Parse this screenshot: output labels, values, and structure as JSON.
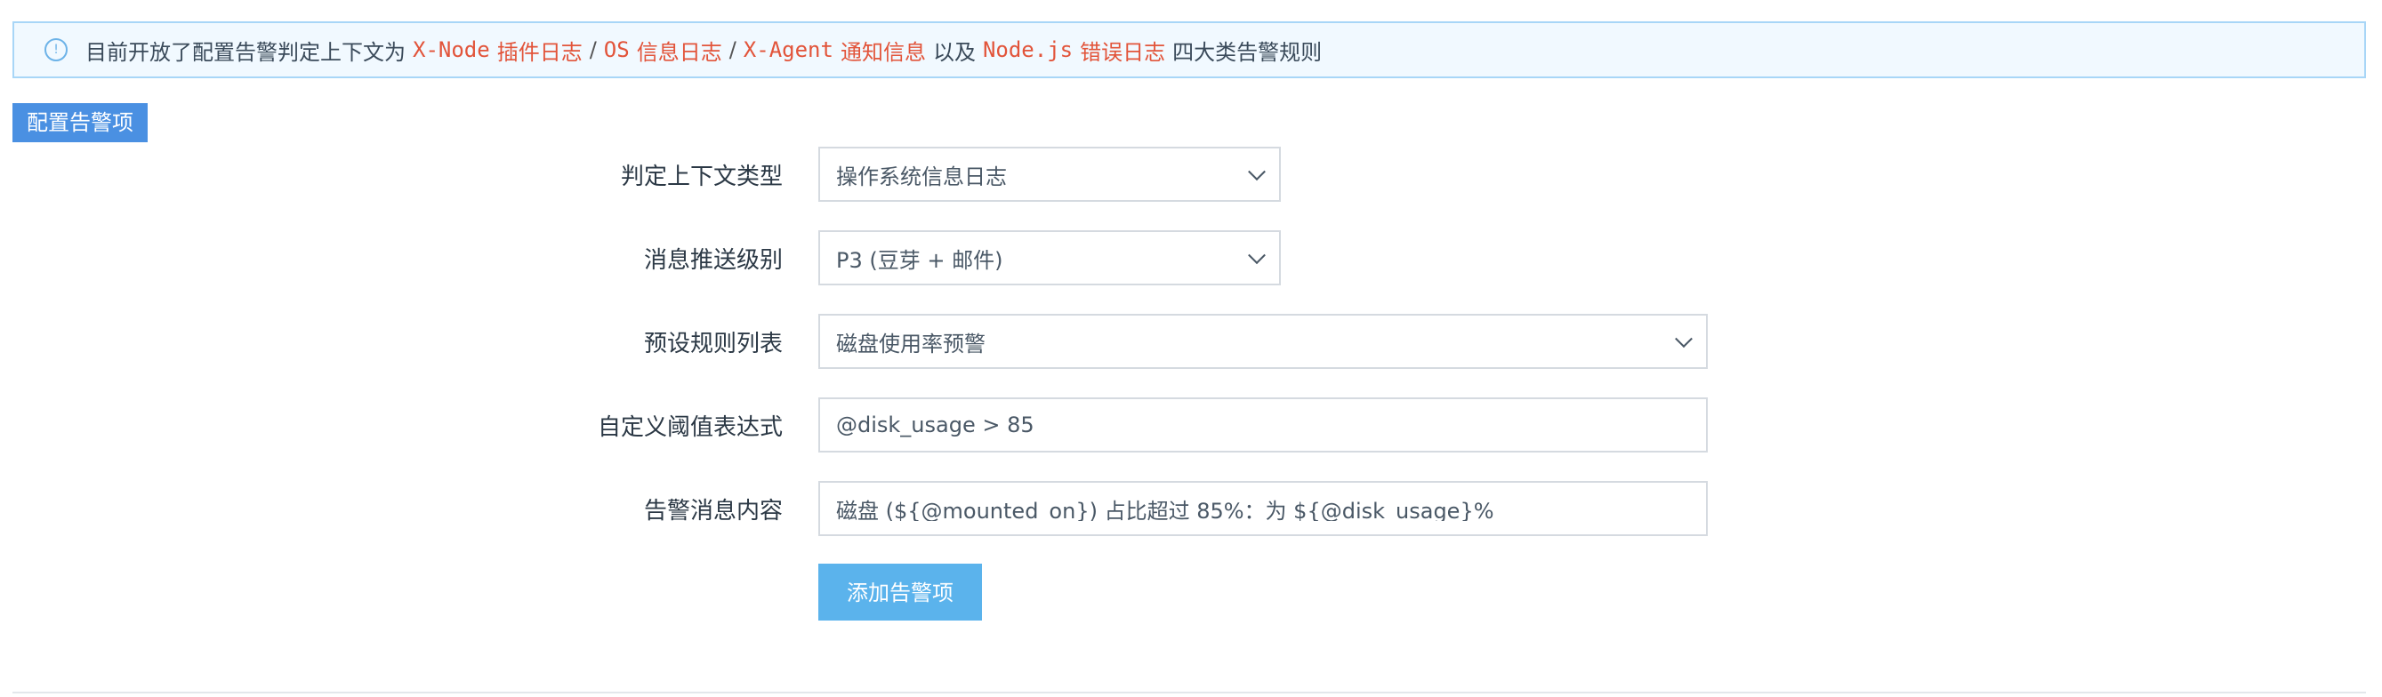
{
  "notice": {
    "icon": "info-icon",
    "prefix": "目前开放了配置告警判定上下文为",
    "items": [
      {
        "code": "X-Node",
        "text": "插件日志"
      },
      {
        "code": "OS",
        "text": "信息日志"
      },
      {
        "code": "X-Agent",
        "text": "通知信息"
      }
    ],
    "separator": "/",
    "conjunction": "以及",
    "last_item": {
      "code": "Node.js",
      "text": "错误日志"
    },
    "suffix": "四大类告警规则"
  },
  "section": {
    "title": "配置告警项"
  },
  "form": {
    "context_type": {
      "label": "判定上下文类型",
      "value": "操作系统信息日志"
    },
    "push_level": {
      "label": "消息推送级别",
      "value": "P3 (豆芽 + 邮件)"
    },
    "preset_rules": {
      "label": "预设规则列表",
      "value": "磁盘使用率预警"
    },
    "threshold_expr": {
      "label": "自定义阈值表达式",
      "value": "@disk_usage > 85"
    },
    "alert_message": {
      "label": "告警消息内容",
      "value": "磁盘 (${@mounted_on}) 占比超过 85%：为 ${@disk_usage}%"
    },
    "submit_label": "添加告警项"
  },
  "colors": {
    "accent": "#4a90e2",
    "button": "#5bb3ec",
    "code": "#e2543a",
    "notice_bg": "#f1f9ff",
    "notice_border": "#a8d6f7"
  }
}
